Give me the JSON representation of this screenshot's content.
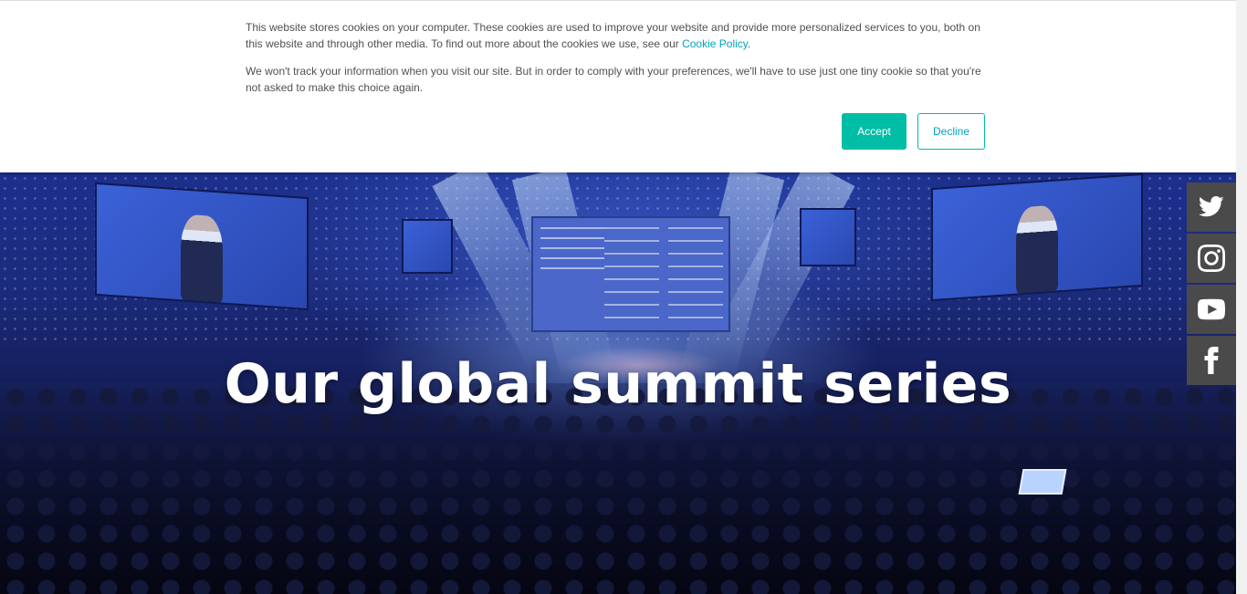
{
  "cookie_banner": {
    "text_1": "This website stores cookies on your computer. These cookies are used to improve your website and provide more personalized services to you, both on this website and through other media. To find out more about the cookies we use, see our",
    "policy_link": "Cookie Policy",
    "text_1_end": ".",
    "text_2": "We won't track your information when you visit our site. But in order to comply with your preferences, we'll have to use just one tiny cookie so that you're not asked to make this choice again.",
    "accept_label": "Accept",
    "decline_label": "Decline",
    "accent_color": "#00bda5",
    "link_color": "#00a4bd"
  },
  "hero": {
    "title": "Our global summit series"
  },
  "social": {
    "items": [
      {
        "icon": "twitter-icon"
      },
      {
        "icon": "instagram-icon"
      },
      {
        "icon": "youtube-icon"
      },
      {
        "icon": "facebook-icon"
      }
    ],
    "button_color": "#4a4a4a"
  }
}
